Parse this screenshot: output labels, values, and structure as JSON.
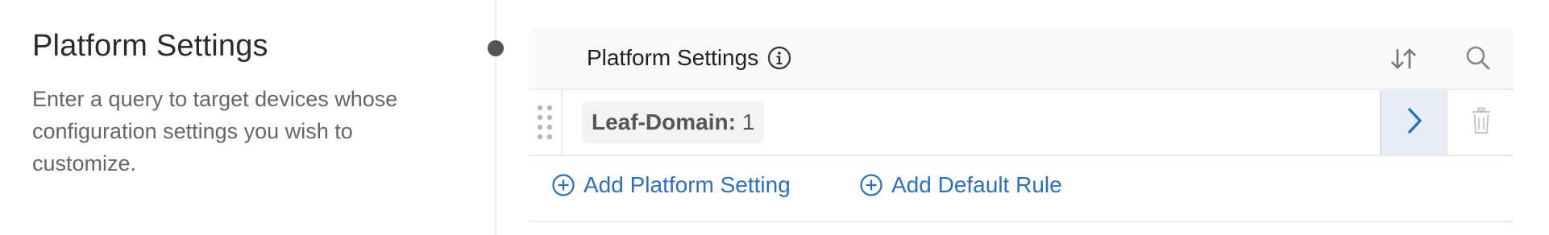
{
  "section": {
    "title": "Platform Settings",
    "description": "Enter a query to target devices whose configuration settings you wish to customize."
  },
  "panel": {
    "title": "Platform Settings",
    "icons": {
      "info": "info-circle-icon",
      "sort": "sort-arrows-icon",
      "search": "search-icon"
    },
    "rules": [
      {
        "key": "Leaf-Domain:",
        "value": "1"
      }
    ],
    "actions": {
      "add_platform_setting": "Add Platform Setting",
      "add_default_rule": "Add Default Rule"
    }
  },
  "colors": {
    "accent": "#2f6fb7",
    "header_bg": "#f8f9fb",
    "selected_cell_bg": "#e6edf7"
  }
}
